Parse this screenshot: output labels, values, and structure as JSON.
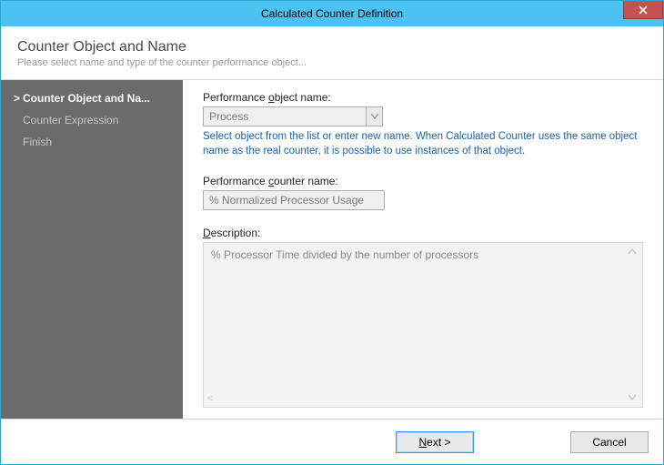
{
  "titlebar": {
    "title": "Calculated Counter Definition"
  },
  "header": {
    "title": "Counter Object and Name",
    "subtitle": "Please select name and type of the counter performance object..."
  },
  "sidebar": {
    "items": [
      {
        "label": "Counter Object and Na...",
        "active": true
      },
      {
        "label": "Counter Expression",
        "active": false
      },
      {
        "label": "Finish",
        "active": false
      }
    ]
  },
  "form": {
    "object_label_pre": "Performance ",
    "object_label_u": "o",
    "object_label_post": "bject name:",
    "object_value": "Process",
    "hint": "Select object from the list or enter new name. When Calculated Counter uses the same object name as the real counter, it is possible to use instances of that object.",
    "counter_label_pre": "Performance ",
    "counter_label_u": "c",
    "counter_label_post": "ounter name:",
    "counter_value": "% Normalized Processor Usage",
    "desc_label_u": "D",
    "desc_label_post": "escription:",
    "desc_value": "% Processor Time divided by the number of processors"
  },
  "footer": {
    "next_u": "N",
    "next_post": "ext >",
    "cancel": "Cancel"
  }
}
